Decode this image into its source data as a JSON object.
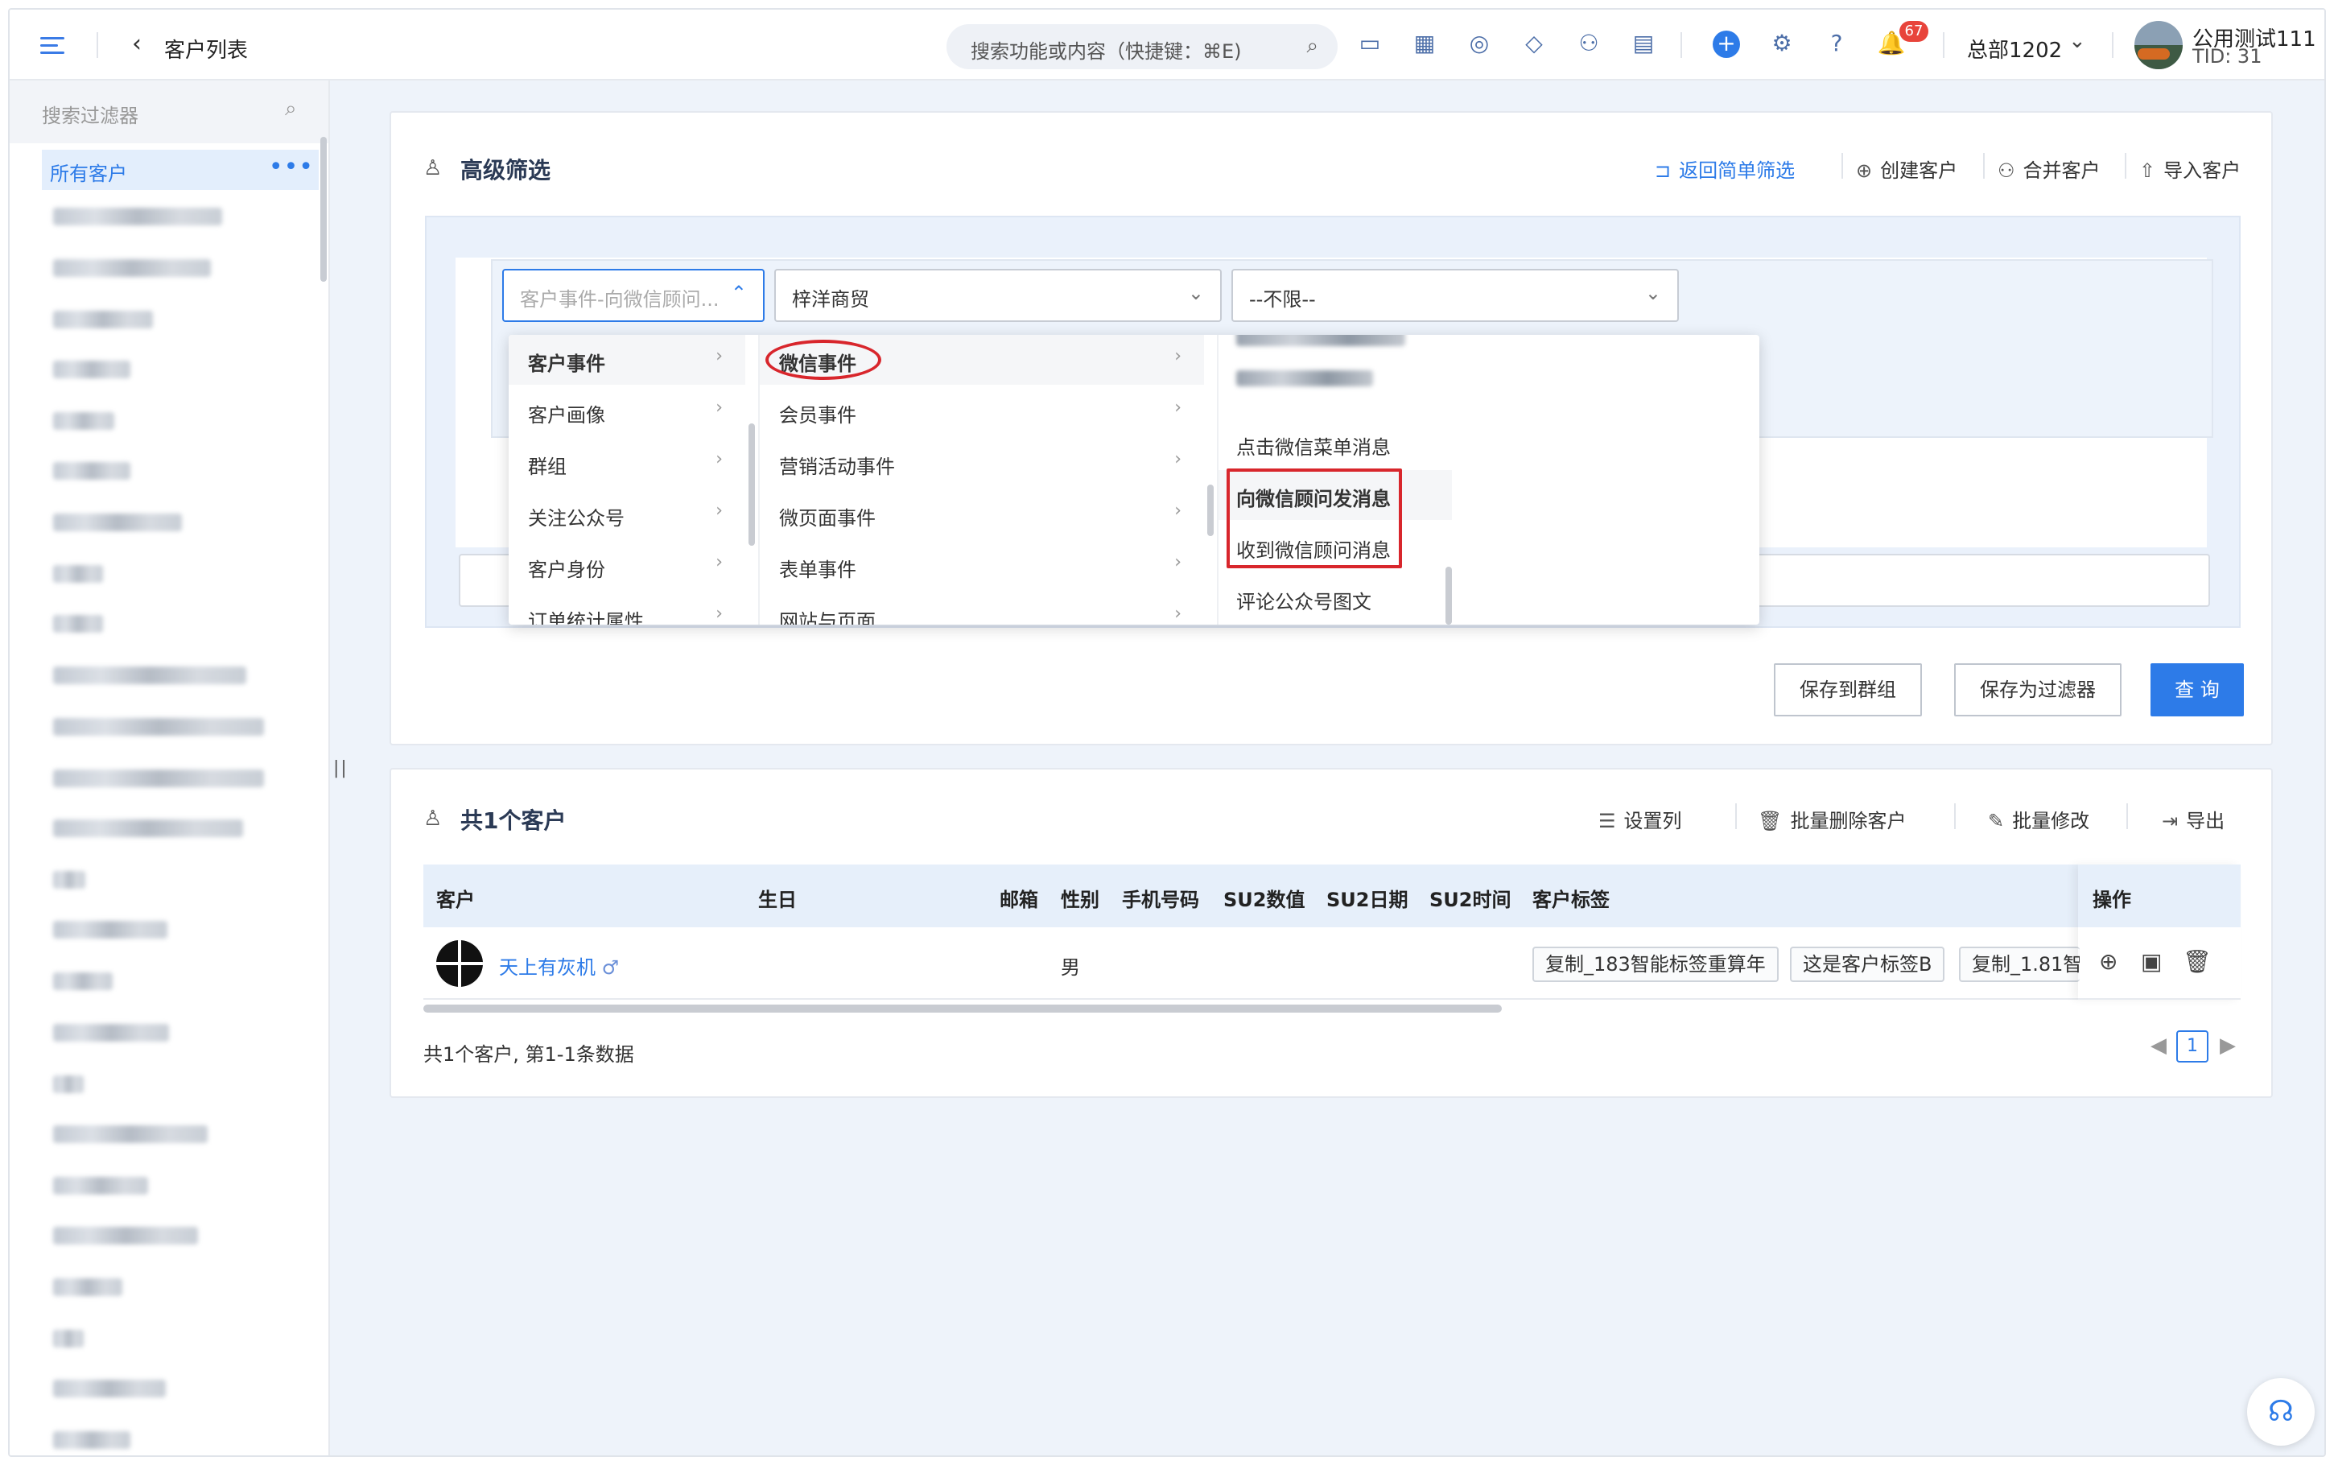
{
  "topbar": {
    "back_label": "客户列表",
    "search_placeholder": "搜索功能或内容（快捷键：⌘E)",
    "notification_count": "67",
    "org_name": "总部1202",
    "user_name": "公用测试111",
    "tid": "TID: 31"
  },
  "sidebar": {
    "search_placeholder": "搜索过滤器",
    "active_item": "所有客户",
    "more": "•••"
  },
  "filter": {
    "title": "高级筛选",
    "back_simple": "返回简单筛选",
    "create_customer": "创建客户",
    "merge_customer": "合并客户",
    "import_customer": "导入客户",
    "select1_placeholder": "客户事件-向微信顾问...",
    "select2_value": "梓洋商贸",
    "select3_value": "--不限--",
    "save_group": "保存到群组",
    "save_filter": "保存为过滤器",
    "query": "查 询"
  },
  "cascader": {
    "col1": [
      "客户事件",
      "客户画像",
      "群组",
      "关注公众号",
      "客户身份",
      "订单统计属性"
    ],
    "col2": [
      "微信事件",
      "会员事件",
      "营销活动事件",
      "微页面事件",
      "表单事件",
      "网站与页面"
    ],
    "col3": [
      "点击微信菜单消息",
      "向微信顾问发消息",
      "收到微信顾问消息",
      "评论公众号图文"
    ]
  },
  "results": {
    "title": "共1个客户",
    "set_columns": "设置列",
    "batch_delete": "批量删除客户",
    "batch_edit": "批量修改",
    "export": "导出",
    "columns": [
      "客户",
      "生日",
      "邮箱",
      "性别",
      "手机号码",
      "SU2数值",
      "SU2日期",
      "SU2时间",
      "客户标签",
      "操作"
    ],
    "row": {
      "name": "天上有灰机",
      "gender_symbol": "♂",
      "gender": "男",
      "tags": [
        "复制_183智能标签重算年",
        "这是客户标签B",
        "复制_1.81智"
      ]
    },
    "summary": "共1个客户, 第1-1条数据",
    "page": "1"
  }
}
